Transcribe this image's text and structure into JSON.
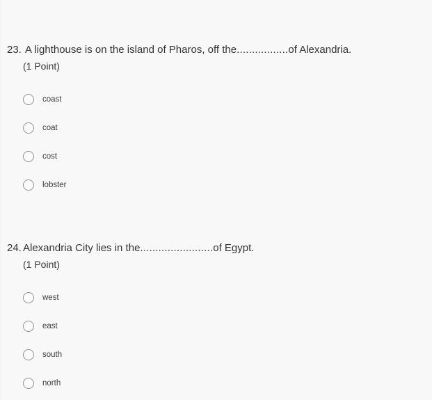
{
  "page": {
    "background_color": "#f8f8f8",
    "text_color": "#333333",
    "radio_border_color": "#909090"
  },
  "questions": [
    {
      "number": "23.",
      "text_before": "A lighthouse is on the island of Pharos, off the ",
      "dots": ".................",
      "text_after": "of Alexandria.",
      "full_text": "A lighthouse is on the island of Pharos, off the .................of Alexandria.",
      "points": "(1 Point)",
      "options": [
        {
          "label": "coast",
          "selected": false
        },
        {
          "label": "coat",
          "selected": false
        },
        {
          "label": "cost",
          "selected": false
        },
        {
          "label": "lobster",
          "selected": false
        }
      ]
    },
    {
      "number": "24.",
      "text_before": "Alexandria City lies in the ",
      "dots": "........................",
      "text_after": "of Egypt.",
      "full_text": "Alexandria City lies in the ........................of Egypt.",
      "points": "(1 Point)",
      "options": [
        {
          "label": "west",
          "selected": false
        },
        {
          "label": "east",
          "selected": false
        },
        {
          "label": "south",
          "selected": false
        },
        {
          "label": "north",
          "selected": false
        }
      ]
    }
  ]
}
